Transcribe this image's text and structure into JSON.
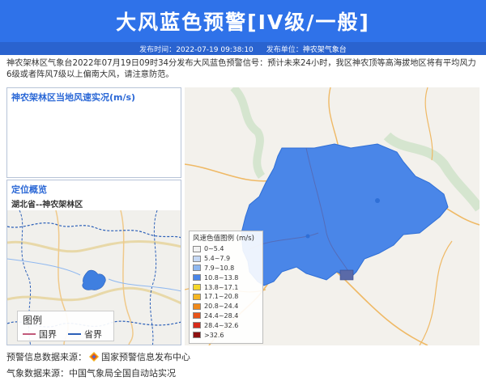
{
  "header": {
    "title": "大风蓝色预警[IV级/一般]",
    "publish_time_label": "发布时间：",
    "publish_time": "2022-07-19 09:38:10",
    "issuer_label": "发布单位：",
    "issuer": "神农架气象台",
    "banner_color": "#2f72e9"
  },
  "notice": {
    "text": "神农架林区气象台2022年07月19日09时34分发布大风蓝色预警信号：预计未来24小时，我区神农顶等高海拔地区将有平均风力6级或者阵风7级以上偏南大风，请注意防范。"
  },
  "wind_panel": {
    "title": "神农架林区当地风速实况(m/s)"
  },
  "location_panel": {
    "title": "定位概览",
    "subtitle": "湖北省--神农架林区",
    "legend_title": "图例",
    "legend_items": [
      {
        "label": "国界",
        "color": "#c25a7a"
      },
      {
        "label": "省界",
        "color": "#2b5fb8"
      }
    ]
  },
  "scale_legend": {
    "title": "风速色值图例 (m/s)",
    "items": [
      {
        "label": "0~5.4",
        "color": "#f2f2f2"
      },
      {
        "label": "5.4~7.9",
        "color": "#c6d9f5"
      },
      {
        "label": "7.9~10.8",
        "color": "#8fb8f0"
      },
      {
        "label": "10.8~13.8",
        "color": "#4a86e8"
      },
      {
        "label": "13.8~17.1",
        "color": "#f5d72a"
      },
      {
        "label": "17.1~20.8",
        "color": "#f5b623"
      },
      {
        "label": "20.8~24.4",
        "color": "#f08a1c"
      },
      {
        "label": "24.4~28.4",
        "color": "#e8541a"
      },
      {
        "label": "28.4~32.6",
        "color": "#d62b1a"
      },
      {
        "label": ">32.6",
        "color": "#8e1010"
      }
    ]
  },
  "footer": {
    "line1_label": "预警信息数据来源：",
    "line1_value": "国家预警信息发布中心",
    "line2_label": "气象数据来源：",
    "line2_value": "中国气象局全国自动站实况"
  }
}
